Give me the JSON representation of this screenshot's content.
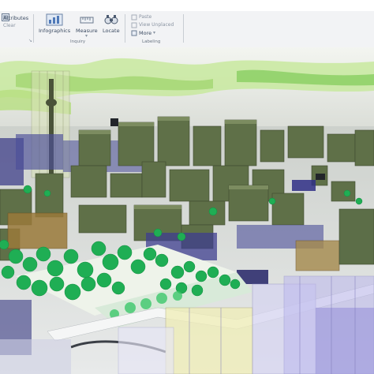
{
  "ribbon": {
    "attributes_label": "Attributes",
    "clear_label": "Clear",
    "infographics_label": "Infographics",
    "measure_label": "Measure",
    "locate_label": "Locate",
    "inquiry_group": "Inquiry",
    "paste_label": "Paste",
    "view_unplaced_label": "View Unplaced",
    "more_label": "More",
    "labeling_group": "Labeling"
  },
  "colors": {
    "ribbon_bg": "#f2f3f5",
    "accent": "#2e6fb5",
    "building": "#5f7048",
    "tree": "#1fae54",
    "selected_volume": "#4b4f9a"
  },
  "icons": [
    "attributes-icon",
    "infographics-icon",
    "measure-icon",
    "locate-icon",
    "paste-icon",
    "view-unplaced-icon",
    "more-icon"
  ]
}
